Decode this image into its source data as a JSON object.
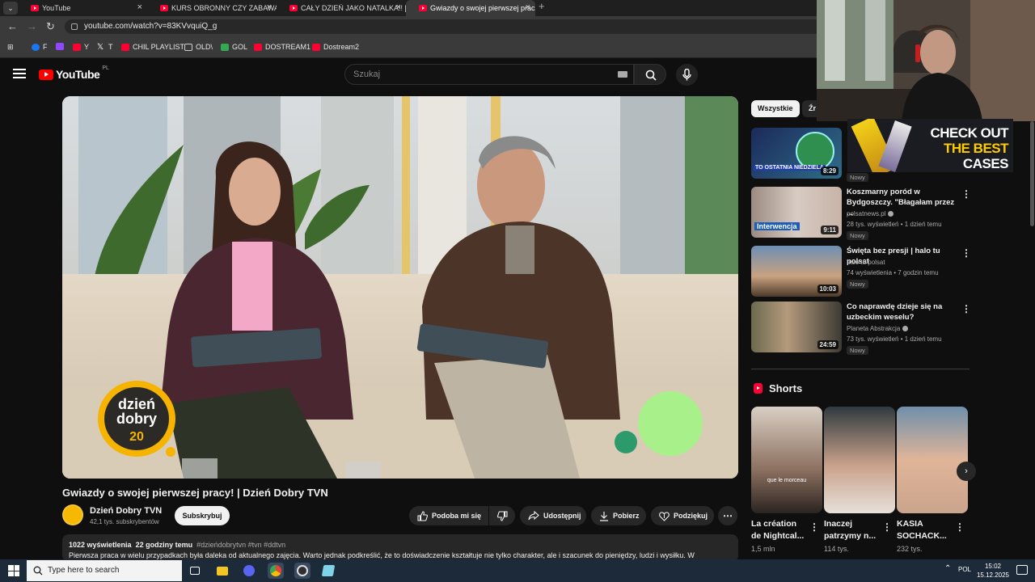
{
  "browser": {
    "tabs": [
      {
        "title": "YouTube",
        "active": false
      },
      {
        "title": "KURS OBRONNY CZY ZABAWA",
        "active": false
      },
      {
        "title": "CAŁY DZIEŃ JAKO NATALKA!! [",
        "active": false
      },
      {
        "title": "Gwiazdy o swojej pierwszej prac",
        "active": true
      }
    ],
    "url": "youtube.com/watch?v=83KVvquiQ_g",
    "bookmarks": [
      {
        "label": "F",
        "color": "#1877f2"
      },
      {
        "label": "",
        "color": "#9146ff"
      },
      {
        "label": "Y",
        "color": "#ff0033"
      },
      {
        "label": "T",
        "color": "#ffffff"
      },
      {
        "label": "CHIL PLAYLIST",
        "color": "#ff0033"
      },
      {
        "label": "OLD\\",
        "color": "#cccccc"
      },
      {
        "label": "GOL",
        "color": "#34a853"
      },
      {
        "label": "DOSTREAM1",
        "color": "#ff0033"
      },
      {
        "label": "Dostream2",
        "color": "#ff0033"
      }
    ]
  },
  "header": {
    "logo_text": "YouTube",
    "logo_region": "PL",
    "search_placeholder": "Szukaj"
  },
  "player": {
    "logo_line1": "dzień",
    "logo_line2": "dobry",
    "logo_badge": "20"
  },
  "video": {
    "title": "Gwiazdy o swojej pierwszej pracy! | Dzień Dobry TVN",
    "channel_name": "Dzień Dobry TVN",
    "channel_subs": "42,1 tys. subskrybentów",
    "subscribe_label": "Subskrybuj",
    "like_label": "Podoba mi się",
    "share_label": "Udostępnij",
    "download_label": "Pobierz",
    "thanks_label": "Podziękuj",
    "views": "1022 wyświetlenia",
    "age": "22 godziny temu",
    "tags": "#dzieńdobrytvn #tvn #ddtvn",
    "description": "Pierwsza praca w wielu przypadkach była daleka od aktualnego zajęcia. Warto jednak podkreślić, że to doświadczenie kształtuje nie tylko charakter, ale i szacunek do pieniędzy, ludzi i wysiłku. W"
  },
  "sidebar": {
    "chips": [
      "Wszystkie",
      "Źr"
    ],
    "recommendations": [
      {
        "title": "",
        "channel": "",
        "meta": "",
        "duration": "8:29",
        "badge": "Nowy",
        "thumb_caption": "TO OSTATNIA NIEDZIELA"
      },
      {
        "title": "Koszmarny poród w Bydgoszczy. \"Błagałam przez ...",
        "channel": "polsatnews.pl",
        "meta": "28 tys. wyświetleń • 1 dzień temu",
        "duration": "9:11",
        "badge": "Nowy",
        "thumb_caption": "Interwencja"
      },
      {
        "title": "Święta bez presji | halo tu polsat",
        "channel": "halo tu polsat",
        "meta": "74 wyświetlenia • 7 godzin temu",
        "duration": "10:03",
        "badge": "Nowy",
        "thumb_caption": ""
      },
      {
        "title": "Co naprawdę dzieje się na uzbeckim weselu?",
        "channel": "Planeta Abstrakcja",
        "meta": "73 tys. wyświetleń • 1 dzień temu",
        "duration": "24:59",
        "badge": "Nowy",
        "thumb_caption": ""
      }
    ],
    "shorts_heading": "Shorts",
    "shorts": [
      {
        "title": "La création de Nightcal...",
        "views": "1,5 mln",
        "caption": "que le morceau"
      },
      {
        "title": "Inaczej patrzymy n...",
        "views": "114 tys."
      },
      {
        "title": "KASIA SOCHACK...",
        "views": "232 tys."
      }
    ]
  },
  "ad": {
    "line1": "CHECK OUT",
    "line2": "THE BEST",
    "line3": "CASES"
  },
  "taskbar": {
    "search_placeholder": "Type here to search",
    "lang": "POL",
    "time": "15:02",
    "date": "15.12.2025"
  }
}
